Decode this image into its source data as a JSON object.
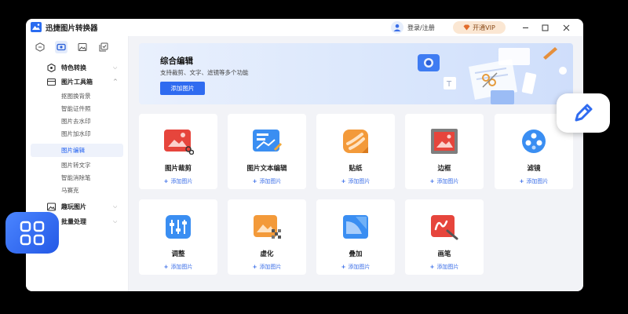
{
  "app": {
    "title": "迅捷图片转换器",
    "login_label": "登录/注册",
    "vip_label": "开通VIP",
    "controls": [
      "minimize",
      "maximize",
      "close"
    ]
  },
  "sidebar": {
    "top_tabs": [
      "format-tab-icon",
      "toolbox-tab-icon",
      "image-tab-icon",
      "batch-tab-icon"
    ],
    "groups": {
      "special": {
        "label": "特色转换"
      },
      "toolbox": {
        "label": "图片工具箱",
        "items": [
          "抠图换背景",
          "智能证件照",
          "图片去水印",
          "图片加水印",
          "图片编辑",
          "图片转文字",
          "智能消除笔",
          "马赛克"
        ]
      },
      "fun": {
        "label": "趣玩图片"
      },
      "batch": {
        "label": "批量处理"
      }
    },
    "active_item": "图片编辑"
  },
  "banner": {
    "title": "综合编辑",
    "subtitle": "支持裁剪、文字、滤镜等多个功能",
    "button_label": "添加图片"
  },
  "tools": [
    {
      "name": "图片裁剪",
      "icon": "crop-icon",
      "add_label": "添加图片"
    },
    {
      "name": "图片文本编辑",
      "icon": "text-edit-icon",
      "add_label": "添加图片"
    },
    {
      "name": "贴纸",
      "icon": "sticker-icon",
      "add_label": "添加图片"
    },
    {
      "name": "边框",
      "icon": "frame-icon",
      "add_label": "添加图片"
    },
    {
      "name": "滤镜",
      "icon": "filter-icon",
      "add_label": "添加图片"
    },
    {
      "name": "调整",
      "icon": "adjust-icon",
      "add_label": "添加图片"
    },
    {
      "name": "虚化",
      "icon": "blur-icon",
      "add_label": "添加图片"
    },
    {
      "name": "叠加",
      "icon": "overlay-icon",
      "add_label": "添加图片"
    },
    {
      "name": "画笔",
      "icon": "brush-icon",
      "add_label": "添加图片"
    }
  ],
  "colors": {
    "accent": "#2f6bf0",
    "sidebar_active_bg": "#eef2fb",
    "main_bg": "#f2f3f7",
    "vip_bg": "#fbe7d3"
  }
}
